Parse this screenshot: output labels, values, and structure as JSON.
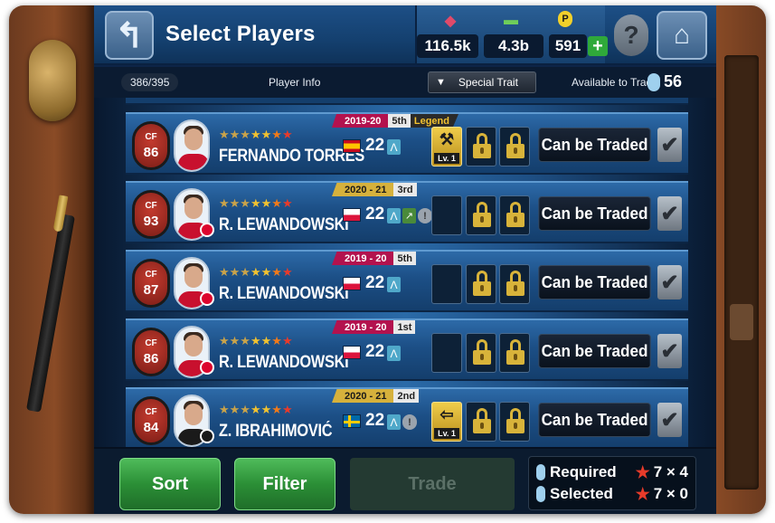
{
  "title": "Select Players",
  "resources": [
    {
      "icon": "gp-icon",
      "value": "116.5k"
    },
    {
      "icon": "cash-icon",
      "value": "4.3b"
    },
    {
      "icon": "coin-icon",
      "value": "591"
    }
  ],
  "header": {
    "count": "386/395",
    "info_label": "Player Info",
    "trait_label": "Special Trait",
    "available_label": "Available to Trade",
    "available_count": "56"
  },
  "players": [
    {
      "position": "CF",
      "rating": "86",
      "name": "FERNANDO TORRES",
      "season": "2019-20",
      "rank": "5th",
      "badge": "Legend",
      "season_color": "red",
      "flag": "es",
      "level": "22",
      "lv_label": "Lv. 1",
      "trade_label": "Can be Traded"
    },
    {
      "position": "CF",
      "rating": "93",
      "name": "R. LEWANDOWSKI",
      "season": "2020 - 21",
      "rank": "3rd",
      "badge": "",
      "season_color": "gold",
      "flag": "pl",
      "level": "22",
      "lv_label": "",
      "trade_label": "Can be Traded"
    },
    {
      "position": "CF",
      "rating": "87",
      "name": "R. LEWANDOWSKI",
      "season": "2019 - 20",
      "rank": "5th",
      "badge": "",
      "season_color": "red",
      "flag": "pl",
      "level": "22",
      "lv_label": "",
      "trade_label": "Can be Traded"
    },
    {
      "position": "CF",
      "rating": "86",
      "name": "R. LEWANDOWSKI",
      "season": "2019 - 20",
      "rank": "1st",
      "badge": "",
      "season_color": "red",
      "flag": "pl",
      "level": "22",
      "lv_label": "",
      "trade_label": "Can be Traded"
    },
    {
      "position": "CF",
      "rating": "84",
      "name": "Z. IBRAHIMOVIĆ",
      "season": "2020 - 21",
      "rank": "2nd",
      "badge": "",
      "season_color": "gold",
      "flag": "se",
      "level": "22",
      "lv_label": "Lv. 1",
      "trade_label": "Can be Traded"
    }
  ],
  "bottom": {
    "sort_label": "Sort",
    "filter_label": "Filter",
    "trade_label": "Trade",
    "required_label": "Required",
    "required_value": "7 × 4",
    "selected_label": "Selected",
    "selected_value": "7 × 0"
  }
}
